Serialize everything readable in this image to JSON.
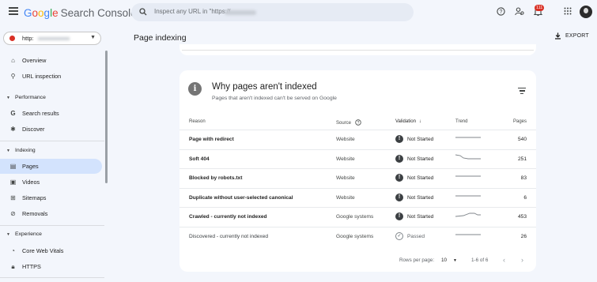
{
  "header": {
    "logo_letters": [
      "G",
      "o",
      "o",
      "g",
      "l",
      "e"
    ],
    "logo_rest": "Search Console",
    "search_placeholder": "Inspect any URL in \"https://",
    "notification_count": "111"
  },
  "sidebar": {
    "property_label": "http:",
    "items_top": [
      {
        "label": "Overview",
        "icon": "home-icon"
      },
      {
        "label": "URL inspection",
        "icon": "search-icon"
      }
    ],
    "sections": [
      {
        "label": "Performance",
        "items": [
          {
            "label": "Search results",
            "icon": "google-g-icon"
          },
          {
            "label": "Discover",
            "icon": "asterisk-icon"
          }
        ]
      },
      {
        "label": "Indexing",
        "items": [
          {
            "label": "Pages",
            "icon": "pages-icon",
            "active": true
          },
          {
            "label": "Videos",
            "icon": "video-icon"
          },
          {
            "label": "Sitemaps",
            "icon": "sitemap-icon"
          },
          {
            "label": "Removals",
            "icon": "removals-icon"
          }
        ]
      },
      {
        "label": "Experience",
        "items": [
          {
            "label": "Core Web Vitals",
            "icon": "gauge-icon"
          },
          {
            "label": "HTTPS",
            "icon": "lock-icon"
          }
        ]
      }
    ]
  },
  "main": {
    "page_title": "Page indexing",
    "export_label": "EXPORT",
    "card": {
      "title": "Why pages aren't indexed",
      "subtitle": "Pages that aren't indexed can't be served on Google",
      "columns": {
        "reason": "Reason",
        "source": "Source",
        "validation": "Validation",
        "trend": "Trend",
        "pages": "Pages"
      },
      "rows": [
        {
          "reason": "Page with redirect",
          "source": "Website",
          "validation": "Not Started",
          "pages": "540",
          "trend": "flat"
        },
        {
          "reason": "Soft 404",
          "source": "Website",
          "validation": "Not Started",
          "pages": "251",
          "trend": "drop"
        },
        {
          "reason": "Blocked by robots.txt",
          "source": "Website",
          "validation": "Not Started",
          "pages": "83",
          "trend": "flat"
        },
        {
          "reason": "Duplicate without user-selected canonical",
          "source": "Website",
          "validation": "Not Started",
          "pages": "6",
          "trend": "flat"
        },
        {
          "reason": "Crawled - currently not indexed",
          "source": "Google systems",
          "validation": "Not Started",
          "pages": "453",
          "trend": "bump"
        },
        {
          "reason": "Discovered - currently not indexed",
          "source": "Google systems",
          "validation": "Passed",
          "pages": "26",
          "trend": "flat"
        }
      ],
      "pager": {
        "rows_per_page_label": "Rows per page:",
        "rows_per_page_value": "10",
        "range": "1-6 of 6"
      }
    }
  }
}
